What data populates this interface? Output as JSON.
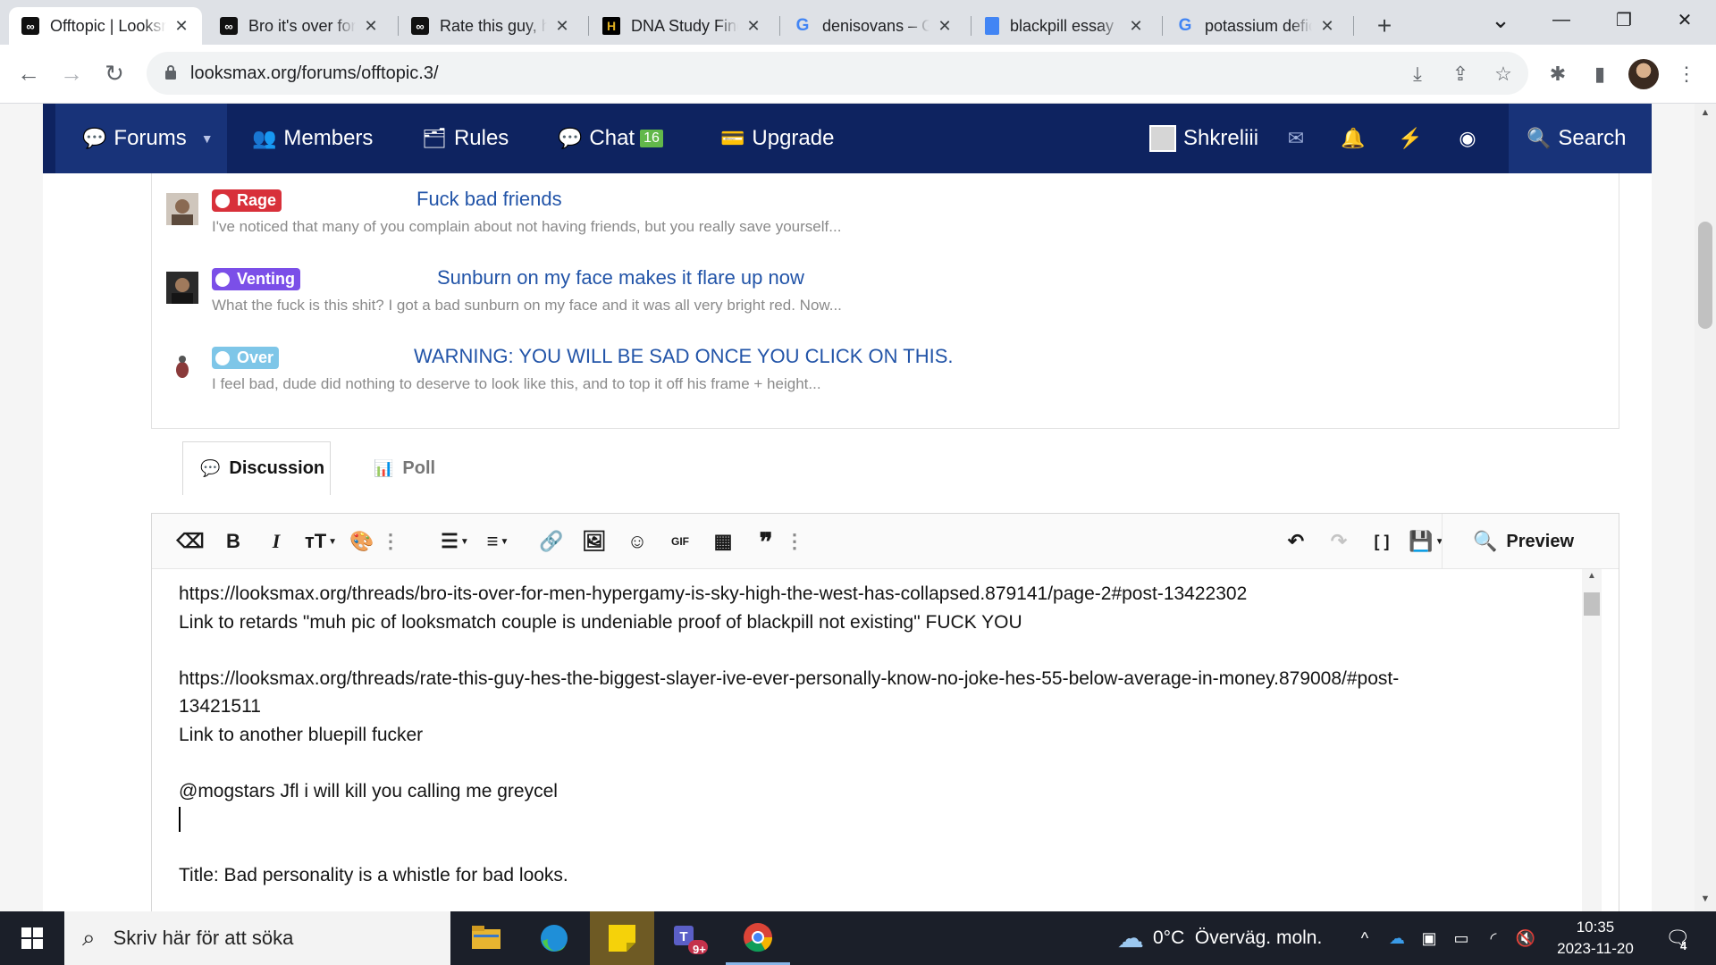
{
  "browser": {
    "tabs": [
      {
        "title": "Offtopic | Looksmax.org",
        "favicon": "looksmax-icon",
        "active": true
      },
      {
        "title": "Bro it's over for men",
        "favicon": "looksmax-icon",
        "active": false
      },
      {
        "title": "Rate this guy, hes the",
        "favicon": "looksmax-icon",
        "active": false
      },
      {
        "title": "DNA Study Finds",
        "favicon": "history-icon",
        "active": false
      },
      {
        "title": "denisovans – Google",
        "favicon": "google-icon",
        "active": false
      },
      {
        "title": "blackpill essay",
        "favicon": "docs-icon",
        "active": false
      },
      {
        "title": "potassium deficiency",
        "favicon": "google-icon",
        "active": false
      }
    ],
    "url": "looksmax.org/forums/offtopic.3/",
    "icons": {
      "back": "←",
      "forward": "→",
      "reload": "↻",
      "new_tab": "+",
      "tab_search": "⌄",
      "minimize": "—",
      "restore": "❐",
      "close": "✕",
      "install": "⤓",
      "share": "⇪",
      "bookmark": "☆",
      "extensions": "✱",
      "side_panel": "▮",
      "menu": "⋮"
    }
  },
  "forum_nav": {
    "items": [
      {
        "label": "Forums",
        "icon": "💬"
      },
      {
        "label": "Members",
        "icon": "👥"
      },
      {
        "label": "Rules",
        "icon": "🗂"
      },
      {
        "label": "Chat",
        "icon": "💬",
        "badge": "16"
      },
      {
        "label": "Upgrade",
        "icon": "💳"
      }
    ],
    "username": "Shkreliii",
    "icons": {
      "inbox": "✉",
      "alerts": "🔔",
      "bolt": "⚡",
      "toggle": "◉",
      "search": "🔍",
      "dropdown": "▼"
    },
    "search_label": "Search",
    "accent": "#0e2360"
  },
  "related_threads": [
    {
      "tag": "Rage",
      "tag_color": "#d8303a",
      "title": "Fuck bad friends",
      "snippet": "I've noticed that many of you complain about not having friends, but you really save yourself..."
    },
    {
      "tag": "Venting",
      "tag_color": "#7b4fe8",
      "title": "Sunburn on my face makes it flare up now",
      "snippet": "What the fuck is this shit? I got a bad sunburn on my face and it was all very bright red. Now..."
    },
    {
      "tag": "Over",
      "tag_color": "#7ec6e8",
      "title": "WARNING: YOU WILL BE SAD ONCE YOU CLICK ON THIS.",
      "snippet": "I feel bad, dude did nothing to deserve to look like this, and to top it off his frame + height..."
    }
  ],
  "post_tabs": {
    "discussion": "Discussion",
    "poll": "Poll"
  },
  "editor": {
    "preview_label": "Preview",
    "toolbar_icons": {
      "eraser": "⌫",
      "bold": "B",
      "italic": "I",
      "text_size": "тT",
      "palette": "🎨",
      "more": "⋮",
      "list": "☰",
      "align": "≡",
      "link": "🔗",
      "image": "🖼",
      "emoji": "☺",
      "gif": "GIF",
      "media": "▦",
      "quote": "❞",
      "undo": "↶",
      "redo": "↷",
      "bbcode": "[ ]",
      "drafts": "💾"
    },
    "lines": [
      "https://looksmax.org/threads/bro-its-over-for-men-hypergamy-is-sky-high-the-west-has-collapsed.879141/page-2#post-13422302",
      "Link to retards \"muh pic of looksmatch couple is undeniable proof of blackpill not existing\" FUCK YOU",
      "",
      "https://looksmax.org/threads/rate-this-guy-hes-the-biggest-slayer-ive-ever-personally-know-no-joke-hes-55-below-average-in-money.879008/#post-",
      "13421511",
      "Link to another bluepill fucker",
      "",
      "@mogstars Jfl i will kill you calling me greycel",
      "",
      "",
      "Title: Bad personality is a whistle for bad looks."
    ]
  },
  "taskbar": {
    "search_placeholder": "Skriv här för att söka",
    "search_icon": "⌕",
    "weather": "0°C  Överväg. moln.",
    "weather_icon": "☁",
    "teams_badge": "9+",
    "time": "10:35",
    "date": "2023-11-20",
    "notification_count": "4",
    "tray_icons": {
      "chevron": "^",
      "onedrive": "☁",
      "security": "▣",
      "battery": "▭",
      "wifi": "◜",
      "volume": "🔇"
    }
  }
}
